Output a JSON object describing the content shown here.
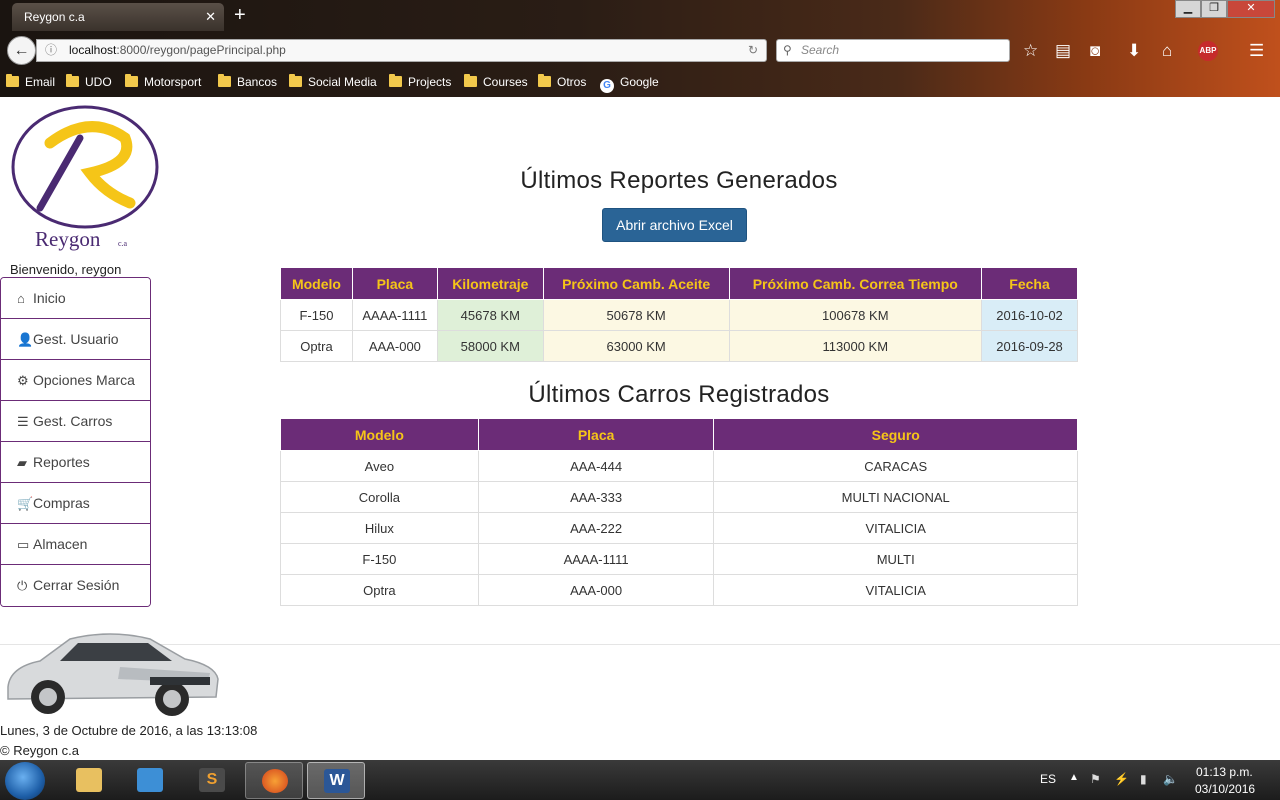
{
  "browser": {
    "tab_title": "Reygon c.a",
    "url_host": "localhost",
    "url_path": ":8000/reygon/pagePrincipal.php",
    "search_placeholder": "Search",
    "abp_label": "ABP",
    "bookmarks": [
      "Email",
      "UDO",
      "Motorsport",
      "Bancos",
      "Social Media",
      "Projects",
      "Courses",
      "Otros",
      "Google"
    ]
  },
  "brand": {
    "name": "Reygon",
    "suffix": "c.a",
    "primary_color": "#6b2c77",
    "accent_color": "#f5c518"
  },
  "welcome_text": "Bienvenido, reygon",
  "menu": [
    {
      "label": "Inicio",
      "icon": "home-icon"
    },
    {
      "label": "Gest. Usuario",
      "icon": "user-icon"
    },
    {
      "label": "Opciones Marca",
      "icon": "gear-icon"
    },
    {
      "label": "Gest. Carros",
      "icon": "list-icon"
    },
    {
      "label": "Reportes",
      "icon": "folder-open-icon"
    },
    {
      "label": "Compras",
      "icon": "cart-icon"
    },
    {
      "label": "Almacen",
      "icon": "inbox-icon"
    },
    {
      "label": "Cerrar Sesión",
      "icon": "power-icon"
    }
  ],
  "reports": {
    "title": "Últimos Reportes Generados",
    "excel_button": "Abrir archivo Excel",
    "headers": [
      "Modelo",
      "Placa",
      "Kilometraje",
      "Próximo Camb. Aceite",
      "Próximo Camb. Correa Tiempo",
      "Fecha"
    ],
    "rows": [
      [
        "F-150",
        "AAAA-1111",
        "45678 KM",
        "50678 KM",
        "100678 KM",
        "2016-10-02"
      ],
      [
        "Optra",
        "AAA-000",
        "58000 KM",
        "63000 KM",
        "113000 KM",
        "2016-09-28"
      ]
    ]
  },
  "cars": {
    "title": "Últimos Carros Registrados",
    "headers": [
      "Modelo",
      "Placa",
      "Seguro"
    ],
    "rows": [
      [
        "Aveo",
        "AAA-444",
        "CARACAS"
      ],
      [
        "Corolla",
        "AAA-333",
        "MULTI NACIONAL"
      ],
      [
        "Hilux",
        "AAA-222",
        "VITALICIA"
      ],
      [
        "F-150",
        "AAAA-1111",
        "MULTI"
      ],
      [
        "Optra",
        "AAA-000",
        "VITALICIA"
      ]
    ]
  },
  "footer": {
    "datetime": "Lunes, 3 de Octubre de 2016, a las 13:13:08",
    "copyright": "© Reygon c.a"
  },
  "taskbar": {
    "language": "ES",
    "time": "01:13 p.m.",
    "date": "03/10/2016",
    "sublime_letter": "S",
    "word_letter": "W"
  }
}
